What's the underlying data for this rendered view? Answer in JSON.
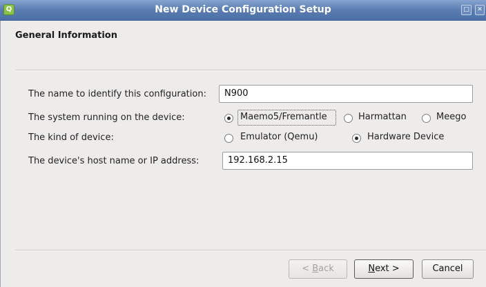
{
  "window": {
    "title": "New Device Configuration Setup",
    "app_icon_glyph": "Q",
    "minimize_glyph": "□",
    "close_glyph": "✕"
  },
  "page": {
    "title": "General Information"
  },
  "form": {
    "name_label": "The name to identify this configuration:",
    "name_value": "N900",
    "system_label": "The system running on the device:",
    "system_options": [
      "Maemo5/Fremantle",
      "Harmattan",
      "Meego"
    ],
    "system_selected": "Maemo5/Fremantle",
    "kind_label": "The kind of device:",
    "kind_options": [
      "Emulator (Qemu)",
      "Hardware Device"
    ],
    "kind_selected": "Hardware Device",
    "host_label": "The device's host name or IP address:",
    "host_value": "192.168.2.15"
  },
  "buttons": {
    "back_prefix": "< ",
    "back_mnemonic": "B",
    "back_rest": "ack",
    "next_mnemonic": "N",
    "next_rest": "ext >",
    "cancel": "Cancel"
  },
  "colors": {
    "titlebar": "#5a7cb0",
    "window_bg": "#edeceb"
  }
}
